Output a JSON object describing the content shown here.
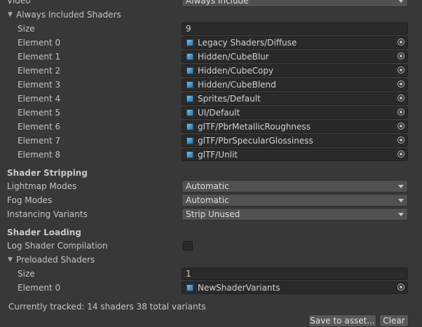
{
  "top": {
    "label": "Video",
    "value": "Always Include"
  },
  "always_included": {
    "label": "Always Included Shaders",
    "size_label": "Size",
    "size_value": "9",
    "elements": [
      {
        "label": "Element 0",
        "value": "Legacy Shaders/Diffuse"
      },
      {
        "label": "Element 1",
        "value": "Hidden/CubeBlur"
      },
      {
        "label": "Element 2",
        "value": "Hidden/CubeCopy"
      },
      {
        "label": "Element 3",
        "value": "Hidden/CubeBlend"
      },
      {
        "label": "Element 4",
        "value": "Sprites/Default"
      },
      {
        "label": "Element 5",
        "value": "UI/Default"
      },
      {
        "label": "Element 6",
        "value": "glTF/PbrMetallicRoughness"
      },
      {
        "label": "Element 7",
        "value": "glTF/PbrSpecularGlossiness"
      },
      {
        "label": "Element 8",
        "value": "glTF/Unlit"
      }
    ]
  },
  "stripping": {
    "header": "Shader Stripping",
    "lightmap": {
      "label": "Lightmap Modes",
      "value": "Automatic"
    },
    "fog": {
      "label": "Fog Modes",
      "value": "Automatic"
    },
    "instancing": {
      "label": "Instancing Variants",
      "value": "Strip Unused"
    }
  },
  "loading": {
    "header": "Shader Loading",
    "log_label": "Log Shader Compilation",
    "log_checked": false,
    "preloaded_label": "Preloaded Shaders",
    "size_label": "Size",
    "size_value": "1",
    "element0_label": "Element 0",
    "element0_value": "NewShaderVariants"
  },
  "footer": {
    "tracked_text": "Currently tracked: 14 shaders 38 total variants",
    "save_button": "Save to asset...",
    "clear_button": "Clear"
  },
  "icons": {
    "fold": "triangle-down",
    "shader_asset": "shader-icon",
    "object_picker": "object-picker-icon",
    "dropdown": "chevron-down-icon"
  }
}
